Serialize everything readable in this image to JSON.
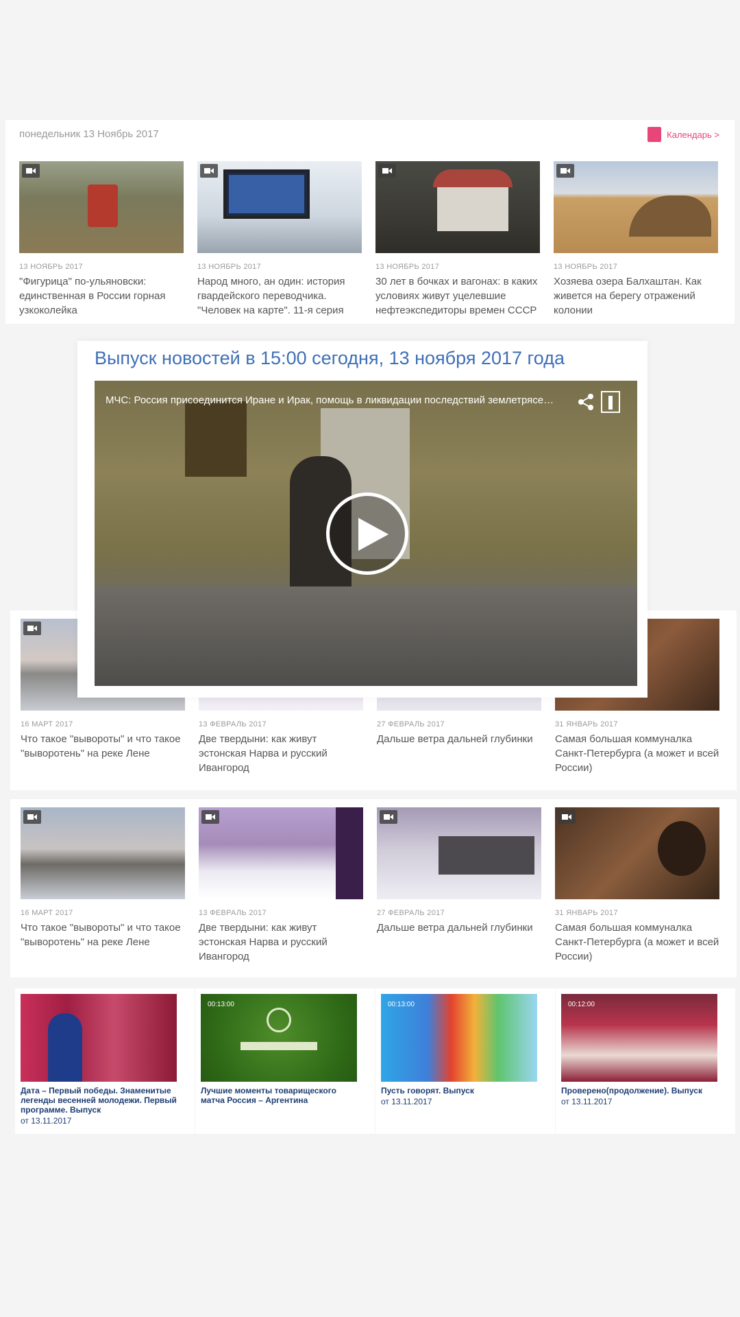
{
  "top_block": {
    "date_header": "понедельник 13 Ноябрь 2017",
    "archive_link": "Календарь >",
    "accent_color": "#e8457a",
    "cards": [
      {
        "date": "13 НОЯБРЬ 2017",
        "title": "\"Фигурица\" по-ульяновски: единственная в России горная узкоколейка"
      },
      {
        "date": "13 НОЯБРЬ 2017",
        "title": "Народ много, ан один: история гвардейского переводчика. \"Человек на карте\". 11-я серия"
      },
      {
        "date": "13 НОЯБРЬ 2017",
        "title": "30 лет в бочках и вагонах: в каких условиях живут уцелевшие нефтеэкспедиторы времен СССР"
      },
      {
        "date": "13 НОЯБРЬ 2017",
        "title": "Хозяева озера Балхаштан. Как живется на берегу отражений колонии"
      }
    ]
  },
  "featured": {
    "title": "Выпуск новостей в 15:00 сегодня, 13 ноября 2017 года",
    "video_caption": "МЧС: Россия присоединится Иране и Ирак, помощь в ликвидации последствий землетрясения"
  },
  "middle_block": {
    "cards": [
      {
        "date": "16 МАРТ 2017",
        "title": "Что такое \"вывороты\" и что такое \"выворотень\" на реке Лене"
      },
      {
        "date": "13 ФЕВРАЛЬ 2017",
        "title": "Две твердыни: как живут эстонская Нарва и русский Ивангород"
      },
      {
        "date": "27 ФЕВРАЛЬ 2017",
        "title": "Дальше ветра дальней глубинки"
      },
      {
        "date": "31 ЯНВАРЬ 2017",
        "title": "Самая большая коммуналка Санкт-Петербурга (а может и всей России)"
      }
    ]
  },
  "lower_block": {
    "cards": [
      {
        "date": "16 МАРТ 2017",
        "title": "Что такое \"вывороты\" и что такое \"выворотень\" на реке Лене"
      },
      {
        "date": "13 ФЕВРАЛЬ 2017",
        "title": "Две твердыни: как живут эстонская Нарва и русский Ивангород"
      },
      {
        "date": "27 ФЕВРАЛЬ 2017",
        "title": "Дальше ветра дальней глубинки"
      },
      {
        "date": "31 ЯНВАРЬ 2017",
        "title": "Самая большая коммуналка Санкт-Петербурга (а может и всей России)"
      }
    ]
  },
  "bottom_tiles": [
    {
      "duration": "",
      "title": "Дата – Первый победы. Знаменитые легенды весенней молодежи. Первый программе. Выпуск",
      "date": "от 13.11.2017"
    },
    {
      "duration": "00:13:00",
      "title": "Лучшие моменты товарищеского матча Россия – Аргентина",
      "date": ""
    },
    {
      "duration": "00:13:00",
      "title": "Пусть говорят. Выпуск",
      "date": "от 13.11.2017"
    },
    {
      "duration": "00:12:00",
      "title": "Проверено(продолжение). Выпуск",
      "date": "от 13.11.2017"
    }
  ]
}
